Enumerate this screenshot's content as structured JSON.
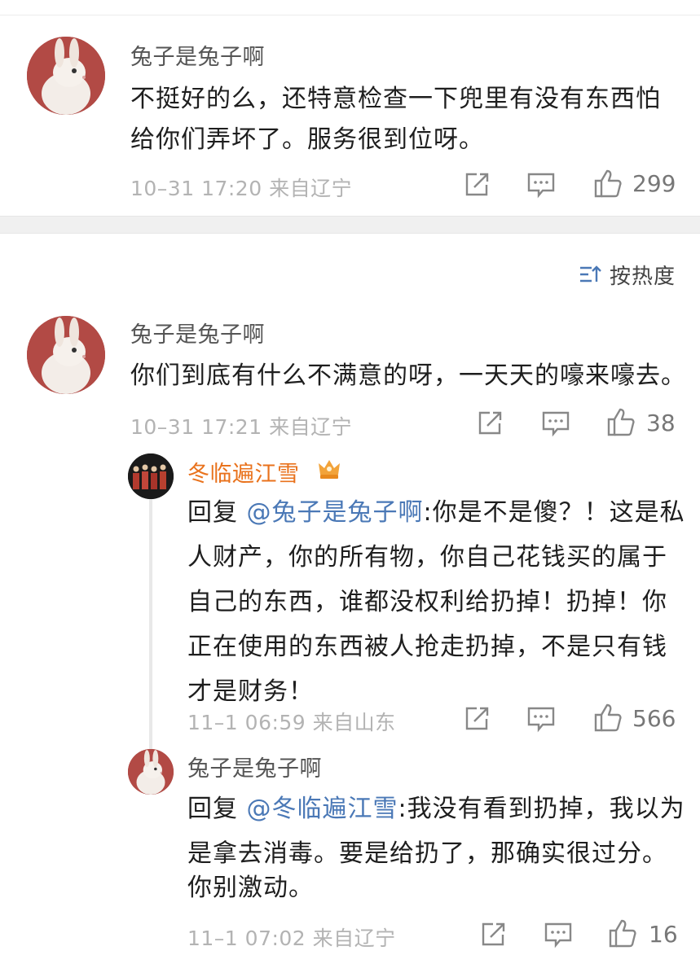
{
  "icons": {
    "share": "share-icon",
    "comment": "comment-icon",
    "like": "thumbs-up-icon",
    "sort": "sort-icon",
    "vip": "crown-badge-icon"
  },
  "colors": {
    "mention": "#4a78b6",
    "vip_name": "#e9721c",
    "meta": "#b3b3b3"
  },
  "top_comment": {
    "username": "兔子是兔子啊",
    "line1": "不挺好的么，还特意检查一下兜里有没有东西怕",
    "line2": "给你们弄坏了。服务很到位呀。",
    "meta": "10–31 17:20 来自辽宁",
    "likes": "299"
  },
  "sort": {
    "label": "按热度"
  },
  "comment2": {
    "username": "兔子是兔子啊",
    "text": "你们到底有什么不满意的呀，一天天的嚎来嚎去。",
    "meta": "10–31 17:21 来自辽宁",
    "likes": "38"
  },
  "reply1": {
    "username": "冬临遍江雪",
    "reply_prefix": "回复 ",
    "mention": "@兔子是兔子啊",
    "line1_rest": ":你是不是傻？！这是私",
    "line2": "人财产，你的所有物，你自己花钱买的属于",
    "line3": "自己的东西，谁都没权利给扔掉！扔掉！你",
    "line4": "正在使用的东西被人抢走扔掉，不是只有钱",
    "line5": "才是财务！",
    "meta": "11–1 06:59 来自山东",
    "likes": "566"
  },
  "reply2": {
    "username": "兔子是兔子啊",
    "reply_prefix": "回复 ",
    "mention": "@冬临遍江雪",
    "line1_rest": ":我没有看到扔掉，我以为",
    "line2": "是拿去消毒。要是给扔了，那确实很过分。",
    "line3": "你别激动。",
    "meta": "11–1 07:02 来自辽宁",
    "likes": "16"
  }
}
